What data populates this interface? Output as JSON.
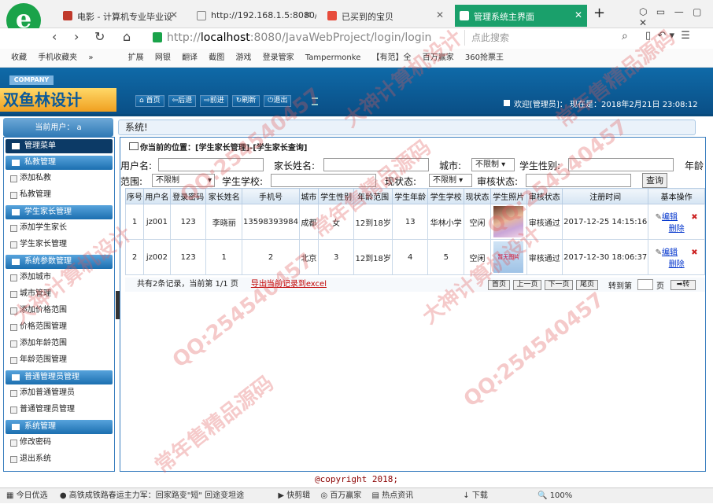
{
  "browser": {
    "tabs": [
      {
        "label": "电影 - 计算机专业毕业设",
        "icon_color": "#c0392b"
      },
      {
        "label": "http://192.168.1.5:8080/",
        "icon_color": "#888888"
      },
      {
        "label": "已买到的宝贝",
        "icon_color": "#e74c3c"
      },
      {
        "label": "管理系统主界面",
        "icon_color": "#ffffff"
      }
    ],
    "new_tab": "+",
    "url_scheme": "http://",
    "url_host": "localhost",
    "url_path": ":8080/JavaWebProject/login/login",
    "search_placeholder": "点此搜索",
    "bookmarks": [
      "收藏",
      "手机收藏夹",
      "»",
      "扩展",
      "网银",
      "翻译",
      "截图",
      "游戏",
      "登录管家",
      "Tampermonke",
      "【有范】全",
      "百万赢家",
      "360抢票王"
    ]
  },
  "header": {
    "company": "COMPANY",
    "brand": "双鱼林设计",
    "nav": [
      "首页",
      "后退",
      "前进",
      "刷新",
      "退出"
    ],
    "welcome": "欢迎[管理员]：  现在是：2018年2月21日  23:08:12"
  },
  "sidebar": {
    "current_user": "当前用户： a",
    "system_message": "系统!",
    "groups": [
      {
        "title": "管理菜单",
        "items": []
      },
      {
        "title": "私教管理",
        "items": [
          "添加私教",
          "私教管理"
        ]
      },
      {
        "title": "学生家长管理",
        "items": [
          "添加学生家长",
          "学生家长管理"
        ]
      },
      {
        "title": "系统参数管理",
        "items": [
          "添加城市",
          "城市管理",
          "添加价格范围",
          "价格范围管理",
          "添加年龄范围",
          "年龄范围管理"
        ]
      },
      {
        "title": "普通管理员管理",
        "items": [
          "添加普通管理员",
          "普通管理员管理"
        ]
      },
      {
        "title": "系统管理",
        "items": [
          "修改密码",
          "退出系统"
        ]
      }
    ]
  },
  "main": {
    "location_prefix": "你当前的位置：",
    "location": "[学生家长管理]-[学生家长查询]",
    "filters": {
      "username_label": "用户名:",
      "parent_name_label": "家长姓名:",
      "city_label": "城市:",
      "city_value": "不限制",
      "gender_label": "学生性别:",
      "age_label": "年龄",
      "age_range_label": "范围:",
      "age_range_value": "不限制",
      "school_label": "学生学校:",
      "status_label": "现状态:",
      "status_value": "不限制",
      "audit_label": "审核状态:",
      "query_button": "查询"
    },
    "columns": [
      "序号",
      "用户名",
      "登录密码",
      "家长姓名",
      "手机号",
      "城市",
      "学生性别",
      "年龄范围",
      "学生年龄",
      "学生学校",
      "现状态",
      "学生照片",
      "审核状态",
      "注册时间",
      "基本操作"
    ],
    "rows": [
      {
        "no": "1",
        "username": "jz001",
        "password": "123",
        "name": "李晓丽",
        "phone": "13598393984",
        "city": "成都",
        "gender": "女",
        "age_range": "12到18岁",
        "age": "13",
        "school": "华林小学",
        "status": "空闲",
        "audit": "审核通过",
        "time": "2017-12-25 14:15:16",
        "edit": "编辑",
        "delete": "删除"
      },
      {
        "no": "2",
        "username": "jz002",
        "password": "123",
        "name": "1",
        "phone": "2",
        "city": "北京",
        "gender": "3",
        "age_range": "12到18岁",
        "age": "4",
        "school": "5",
        "status": "空闲",
        "photo_text": "暂无图片",
        "audit": "审核通过",
        "time": "2017-12-30 18:06:37",
        "edit": "编辑",
        "delete": "删除"
      }
    ],
    "pager": {
      "summary": "共有2条记录，当前第 1/1 页",
      "export": "导出当前记录到excel",
      "buttons": [
        "首页",
        "上一页",
        "下一页",
        "尾页"
      ],
      "goto_label": "转到第",
      "page_suffix": "页",
      "go_button": "转"
    },
    "copyright": "@copyright 2018;"
  },
  "statusbar": [
    "今日优选",
    "高铁成铁路春运主力军：回家路变\"短\" 回途变坦途",
    "快剪辑",
    "百万赢家",
    "热点资讯",
    "下载",
    "100%"
  ],
  "watermarks": [
    "QQ:254540457",
    "大神计算机设计",
    "常年售精品源码"
  ]
}
